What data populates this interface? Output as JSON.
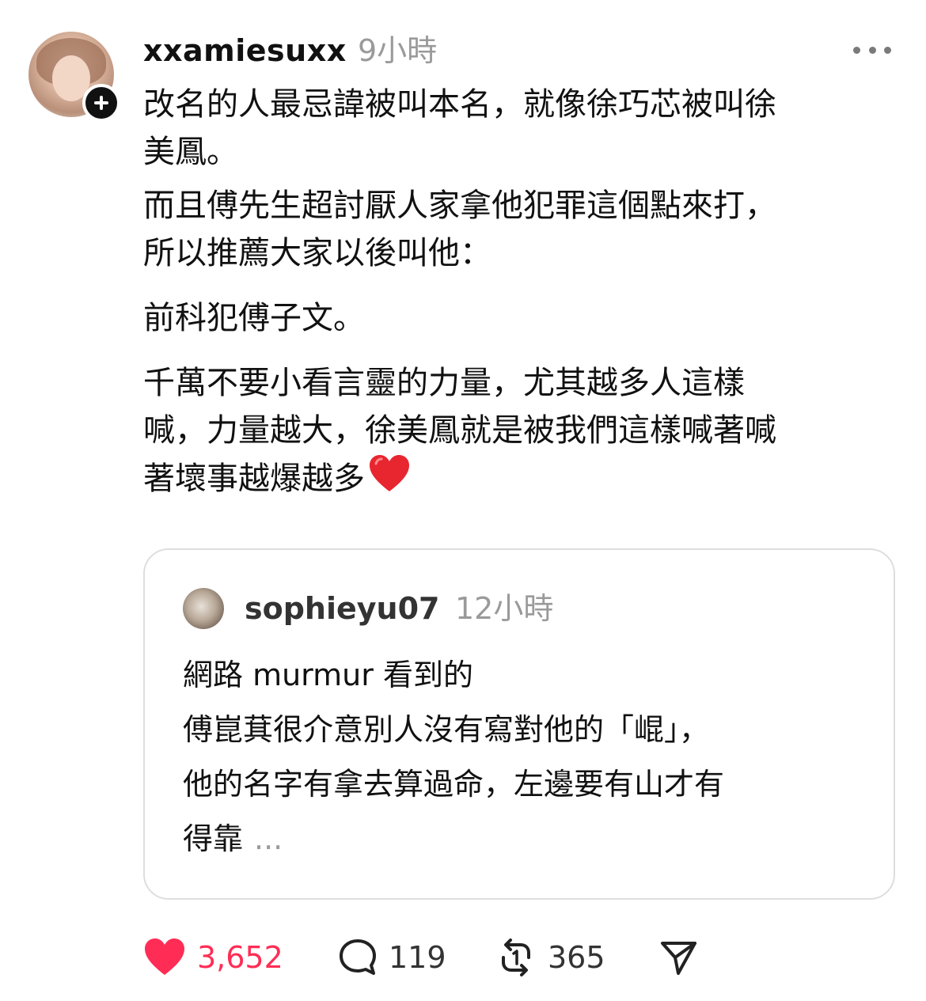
{
  "post": {
    "username": "xxamiesuxx",
    "time": "9小時",
    "lines": [
      "改名的人最忌諱被叫本名，就像徐巧芯被叫徐\n美鳳。",
      "而且傅先生超討厭人家拿他犯罪這個點來打，\n所以推薦大家以後叫他：",
      "前科犯傅子文。",
      "千萬不要小看言靈的力量，尤其越多人這樣\n喊，力量越大，徐美鳳就是被我們這樣喊著喊\n著壞事越爆越多"
    ],
    "trailing_emoji": "red-heart"
  },
  "quoted_post": {
    "username": "sophieyu07",
    "time": "12小時",
    "lines": [
      "網路 murmur 看到的",
      "傅崑萁很介意別人沒有寫對他的「崐」，",
      "他的名字有拿去算過命，左邊要有山才有",
      "得靠"
    ],
    "ellipsis": "..."
  },
  "actions": {
    "like_count": "3,652",
    "reply_count": "119",
    "repost_count": "365"
  },
  "icons": {
    "like": "heart-filled-icon",
    "reply": "speech-bubble-icon",
    "repost": "repost-icon",
    "share": "send-icon",
    "more": "more-horizontal-icon",
    "follow": "plus-icon"
  },
  "colors": {
    "like": "#ff2d55",
    "muted": "#9a9a9a",
    "text": "#111111"
  }
}
